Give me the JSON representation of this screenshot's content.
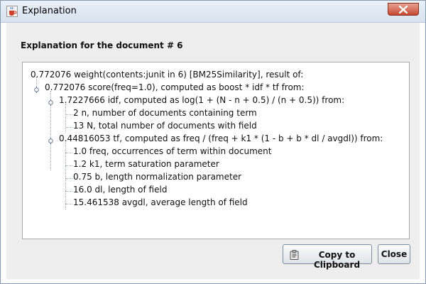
{
  "window": {
    "title": "Explanation",
    "app_icon": "java-cup-icon",
    "close_icon": "close-icon"
  },
  "header": {
    "heading": "Explanation for the document # 6"
  },
  "tree": {
    "root": "0.772076 weight(contents:junit in 6) [BM25Similarity], result of:",
    "score": "0.772076 score(freq=1.0), computed as boost * idf * tf from:",
    "idf": "1.7227666 idf, computed as log(1 + (N - n + 0.5) / (n + 0.5)) from:",
    "idf_n": "2 n, number of documents containing term",
    "idf_N": "13 N, total number of documents with field",
    "tf": "0.44816053 tf, computed as freq / (freq + k1 * (1 - b + b * dl / avgdl)) from:",
    "tf_freq": "1.0 freq, occurrences of term within document",
    "tf_k1": "1.2 k1, term saturation parameter",
    "tf_b": "0.75 b, length normalization parameter",
    "tf_dl": "16.0 dl, length of field",
    "tf_avgdl": "15.461538 avgdl, average length of field"
  },
  "buttons": {
    "copy_label": "Copy to Clipboard",
    "copy_icon": "clipboard-icon",
    "close_label": "Close"
  }
}
